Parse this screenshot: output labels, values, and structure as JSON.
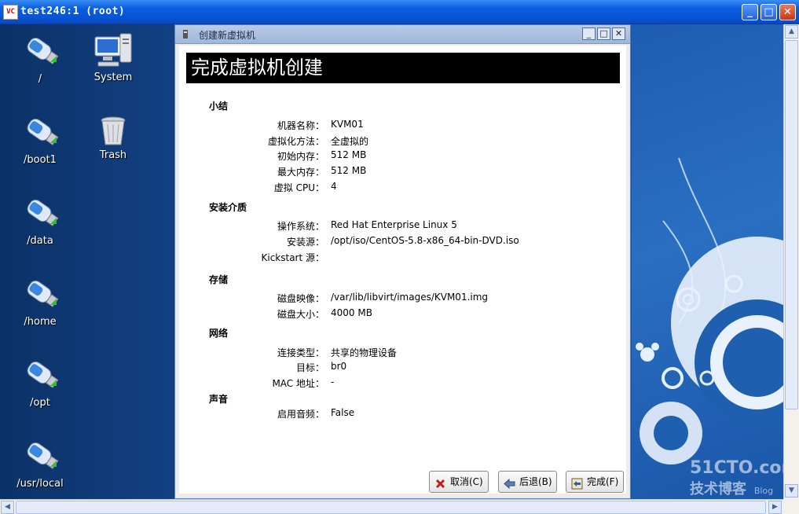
{
  "window": {
    "app_icon": "VC",
    "title": "test246:1 (root)",
    "minimize_icon": "minimize-icon",
    "maximize_icon": "maximize-icon",
    "close_icon": "close-icon"
  },
  "desktop": {
    "icons": [
      {
        "label": "/",
        "icon": "usb-drive-icon"
      },
      {
        "label": "System",
        "icon": "computer-icon"
      },
      {
        "label": "/boot1",
        "icon": "usb-drive-icon"
      },
      {
        "label": "Trash",
        "icon": "trash-icon"
      },
      {
        "label": "/data",
        "icon": "usb-drive-icon"
      },
      {
        "label": "/home",
        "icon": "usb-drive-icon"
      },
      {
        "label": "/opt",
        "icon": "usb-drive-icon"
      },
      {
        "label": "/usr/local",
        "icon": "usb-drive-icon"
      }
    ]
  },
  "dialog": {
    "title": "创建新虚拟机",
    "banner": "完成虚拟机创建",
    "sections": [
      {
        "heading": "小结",
        "rows": [
          {
            "key": "机器名称：",
            "value": "KVM01"
          },
          {
            "key": "虚拟化方法：",
            "value": "全虚拟的"
          },
          {
            "key": "初始内存：",
            "value": "512 MB"
          },
          {
            "key": "最大内存：",
            "value": "512 MB"
          },
          {
            "key": "虚拟 CPU：",
            "value": "4"
          }
        ]
      },
      {
        "heading": "安装介质",
        "rows": [
          {
            "key": "操作系统：",
            "value": "Red Hat Enterprise Linux 5"
          },
          {
            "key": "安装源：",
            "value": "/opt/iso/CentOS-5.8-x86_64-bin-DVD.iso"
          },
          {
            "key": "Kickstart 源：",
            "value": ""
          }
        ]
      },
      {
        "heading": "存储",
        "rows": [
          {
            "key": "磁盘映像：",
            "value": "/var/lib/libvirt/images/KVM01.img"
          },
          {
            "key": "磁盘大小：",
            "value": "4000 MB"
          }
        ]
      },
      {
        "heading": "网络",
        "rows": [
          {
            "key": "连接类型：",
            "value": "共享的物理设备"
          },
          {
            "key": "目标：",
            "value": "br0"
          },
          {
            "key": "MAC 地址：",
            "value": "-"
          }
        ]
      },
      {
        "heading": "声音",
        "rows": [
          {
            "key": "启用音频：",
            "value": "False"
          }
        ]
      }
    ],
    "buttons": {
      "cancel": "取消(C)",
      "back": "后退(B)",
      "finish": "完成(F)"
    }
  },
  "watermark": {
    "line1": "51CTO.com",
    "line2": "技术博客",
    "line3": "Blog"
  }
}
